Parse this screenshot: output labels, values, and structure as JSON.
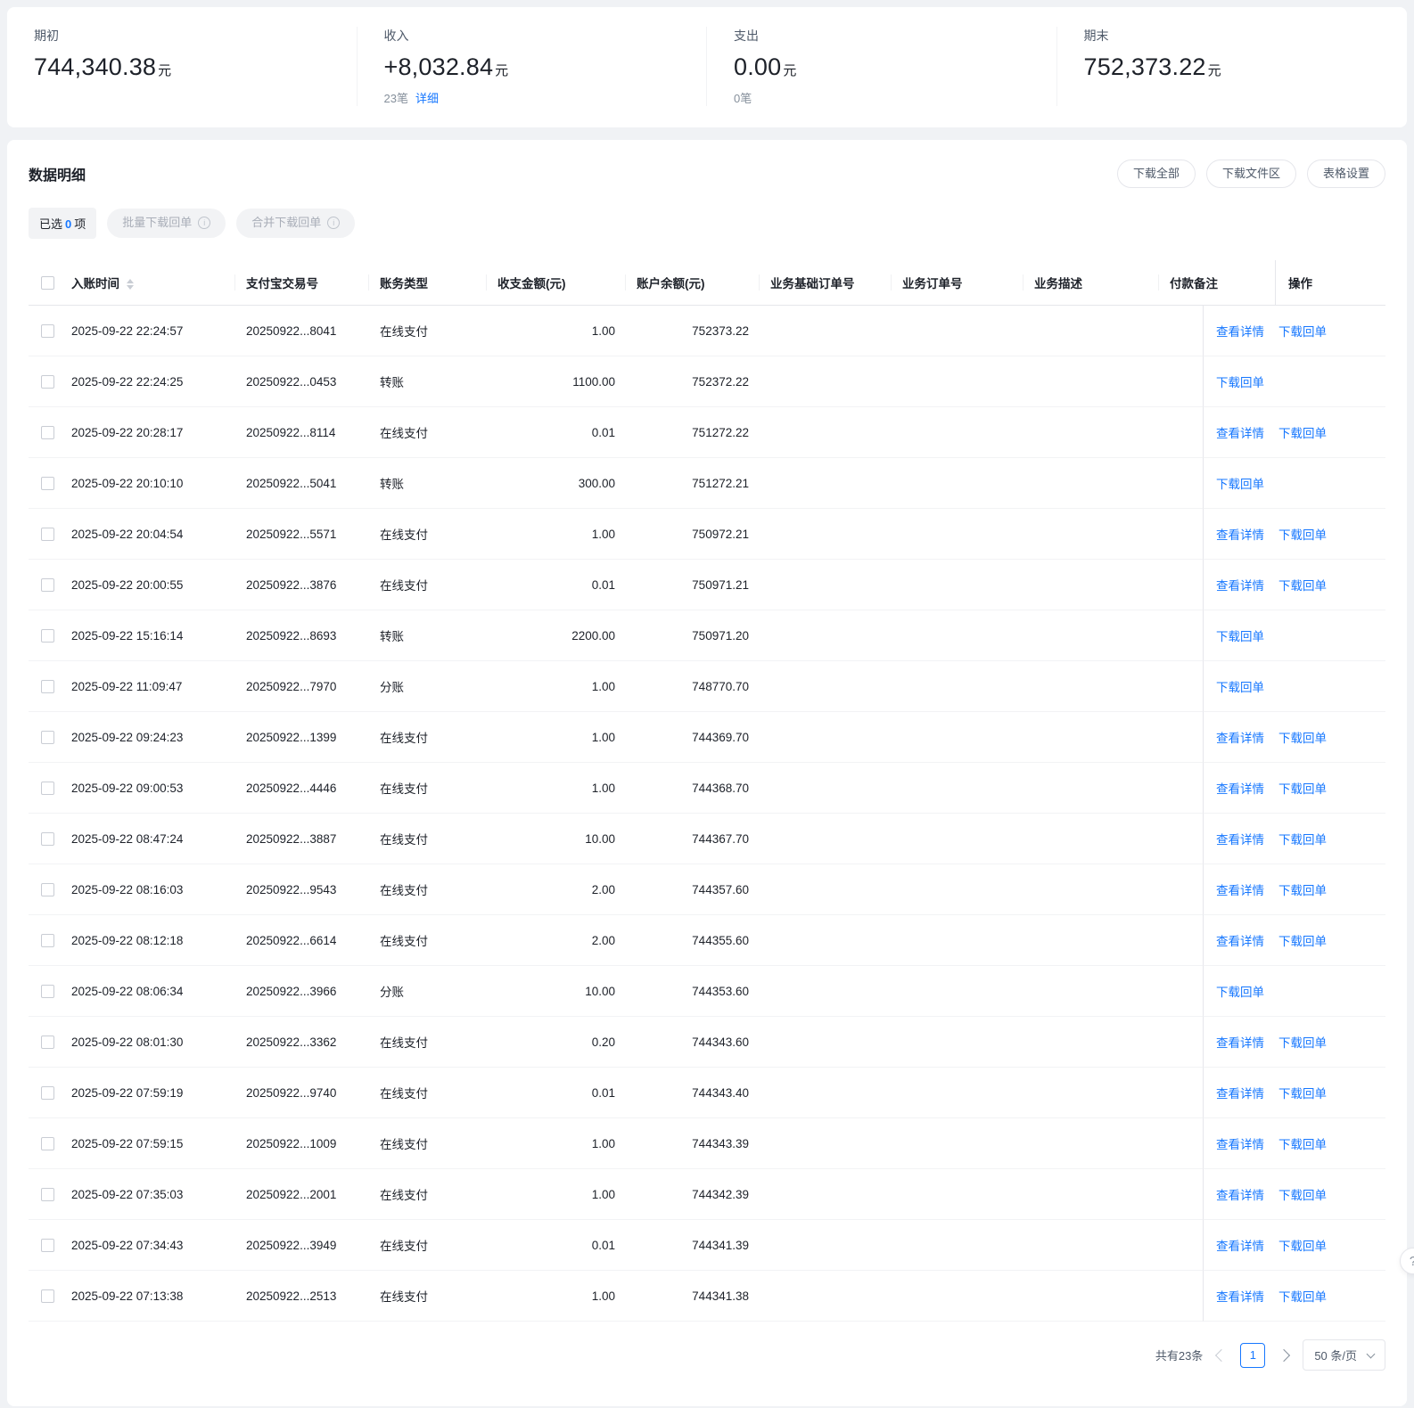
{
  "icons": {
    "info": "i",
    "help": "?"
  },
  "summary": {
    "items": [
      {
        "label": "期初",
        "value": "744,340.38",
        "unit": "元"
      },
      {
        "label": "收入",
        "value": "+8,032.84",
        "unit": "元",
        "count": "23笔",
        "link": "详细"
      },
      {
        "label": "支出",
        "value": "0.00",
        "unit": "元",
        "count": "0笔"
      },
      {
        "label": "期末",
        "value": "752,373.22",
        "unit": "元"
      }
    ]
  },
  "panel": {
    "title": "数据明细",
    "toolbar": {
      "download_all": "下载全部",
      "download_filezone": "下载文件区",
      "table_settings": "表格设置"
    },
    "selection": {
      "prefix": "已选",
      "count": "0",
      "suffix": "项",
      "batch_download": "批量下载回单",
      "merge_download": "合并下载回单"
    }
  },
  "table": {
    "columns": [
      "入账时间",
      "支付宝交易号",
      "账务类型",
      "收支金额(元)",
      "账户余额(元)",
      "业务基础订单号",
      "业务订单号",
      "业务描述",
      "付款备注",
      "操作"
    ],
    "action_labels": {
      "view": "查看详情",
      "download": "下载回单"
    },
    "rows": [
      {
        "time": "2025-09-22 22:24:57",
        "txn": "20250922...8041",
        "type": "在线支付",
        "amount": "1.00",
        "balance": "752373.22",
        "actions": [
          "view",
          "download"
        ]
      },
      {
        "time": "2025-09-22 22:24:25",
        "txn": "20250922...0453",
        "type": "转账",
        "amount": "1100.00",
        "balance": "752372.22",
        "actions": [
          "download"
        ]
      },
      {
        "time": "2025-09-22 20:28:17",
        "txn": "20250922...8114",
        "type": "在线支付",
        "amount": "0.01",
        "balance": "751272.22",
        "actions": [
          "view",
          "download"
        ]
      },
      {
        "time": "2025-09-22 20:10:10",
        "txn": "20250922...5041",
        "type": "转账",
        "amount": "300.00",
        "balance": "751272.21",
        "actions": [
          "download"
        ]
      },
      {
        "time": "2025-09-22 20:04:54",
        "txn": "20250922...5571",
        "type": "在线支付",
        "amount": "1.00",
        "balance": "750972.21",
        "actions": [
          "view",
          "download"
        ]
      },
      {
        "time": "2025-09-22 20:00:55",
        "txn": "20250922...3876",
        "type": "在线支付",
        "amount": "0.01",
        "balance": "750971.21",
        "actions": [
          "view",
          "download"
        ]
      },
      {
        "time": "2025-09-22 15:16:14",
        "txn": "20250922...8693",
        "type": "转账",
        "amount": "2200.00",
        "balance": "750971.20",
        "actions": [
          "download"
        ]
      },
      {
        "time": "2025-09-22 11:09:47",
        "txn": "20250922...7970",
        "type": "分账",
        "amount": "1.00",
        "balance": "748770.70",
        "actions": [
          "download"
        ]
      },
      {
        "time": "2025-09-22 09:24:23",
        "txn": "20250922...1399",
        "type": "在线支付",
        "amount": "1.00",
        "balance": "744369.70",
        "actions": [
          "view",
          "download"
        ]
      },
      {
        "time": "2025-09-22 09:00:53",
        "txn": "20250922...4446",
        "type": "在线支付",
        "amount": "1.00",
        "balance": "744368.70",
        "actions": [
          "view",
          "download"
        ]
      },
      {
        "time": "2025-09-22 08:47:24",
        "txn": "20250922...3887",
        "type": "在线支付",
        "amount": "10.00",
        "balance": "744367.70",
        "actions": [
          "view",
          "download"
        ]
      },
      {
        "time": "2025-09-22 08:16:03",
        "txn": "20250922...9543",
        "type": "在线支付",
        "amount": "2.00",
        "balance": "744357.60",
        "actions": [
          "view",
          "download"
        ]
      },
      {
        "time": "2025-09-22 08:12:18",
        "txn": "20250922...6614",
        "type": "在线支付",
        "amount": "2.00",
        "balance": "744355.60",
        "actions": [
          "view",
          "download"
        ]
      },
      {
        "time": "2025-09-22 08:06:34",
        "txn": "20250922...3966",
        "type": "分账",
        "amount": "10.00",
        "balance": "744353.60",
        "actions": [
          "download"
        ]
      },
      {
        "time": "2025-09-22 08:01:30",
        "txn": "20250922...3362",
        "type": "在线支付",
        "amount": "0.20",
        "balance": "744343.60",
        "actions": [
          "view",
          "download"
        ]
      },
      {
        "time": "2025-09-22 07:59:19",
        "txn": "20250922...9740",
        "type": "在线支付",
        "amount": "0.01",
        "balance": "744343.40",
        "actions": [
          "view",
          "download"
        ]
      },
      {
        "time": "2025-09-22 07:59:15",
        "txn": "20250922...1009",
        "type": "在线支付",
        "amount": "1.00",
        "balance": "744343.39",
        "actions": [
          "view",
          "download"
        ]
      },
      {
        "time": "2025-09-22 07:35:03",
        "txn": "20250922...2001",
        "type": "在线支付",
        "amount": "1.00",
        "balance": "744342.39",
        "actions": [
          "view",
          "download"
        ]
      },
      {
        "time": "2025-09-22 07:34:43",
        "txn": "20250922...3949",
        "type": "在线支付",
        "amount": "0.01",
        "balance": "744341.39",
        "actions": [
          "view",
          "download"
        ]
      },
      {
        "time": "2025-09-22 07:13:38",
        "txn": "20250922...2513",
        "type": "在线支付",
        "amount": "1.00",
        "balance": "744341.38",
        "actions": [
          "view",
          "download"
        ]
      }
    ]
  },
  "pagination": {
    "total": "共有23条",
    "page": "1",
    "page_size": "50 条/页"
  }
}
